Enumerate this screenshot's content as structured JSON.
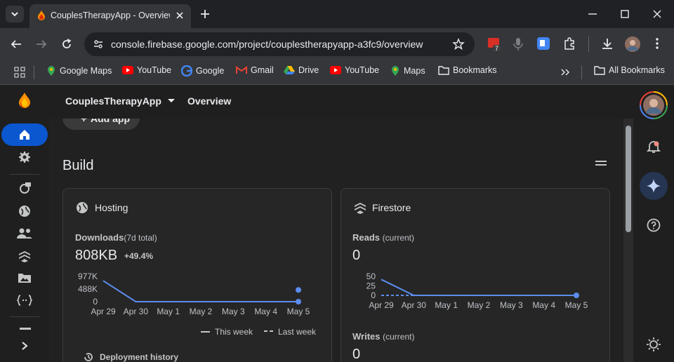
{
  "browser": {
    "tab_title": "CouplesTherapyApp - Overview",
    "url": "console.firebase.google.com/project/couplestherapyapp-a3fc9/overview",
    "extension_badge": "7",
    "bookmarks": [
      "Google Maps",
      "YouTube",
      "Google",
      "Gmail",
      "Drive",
      "YouTube",
      "Maps",
      "Bookmarks"
    ],
    "all_bookmarks": "All Bookmarks"
  },
  "console": {
    "project_name": "CouplesTherapyApp",
    "page_title": "Overview",
    "add_app_label": "Add app",
    "section_title": "Build"
  },
  "hosting": {
    "title": "Hosting",
    "metric_label": "Downloads",
    "metric_qualifier": "(7d total)",
    "metric_value": "808KB",
    "metric_change": "+49.4%",
    "chart_data": {
      "type": "line",
      "categories": [
        "Apr 29",
        "Apr 30",
        "May 1",
        "May 2",
        "May 3",
        "May 4",
        "May 5"
      ],
      "y_ticks": [
        "977K",
        "488K",
        "0"
      ],
      "ylim": [
        0,
        977
      ],
      "series": [
        {
          "name": "This week",
          "values": [
            810,
            0,
            0,
            0,
            0,
            0,
            0
          ],
          "color": "#5b8def",
          "style": "solid"
        },
        {
          "name": "Last week",
          "values": [
            null,
            null,
            null,
            null,
            null,
            null,
            455
          ],
          "color": "#5b8def",
          "style": "dashed"
        }
      ],
      "legend": "bottom-right"
    },
    "legend_this_week": "This week",
    "legend_last_week": "Last week",
    "deployment_history": "Deployment history"
  },
  "firestore": {
    "title": "Firestore",
    "reads_label": "Reads",
    "reads_qualifier": "(current)",
    "reads_value": "0",
    "chart_data": {
      "type": "line",
      "categories": [
        "Apr 29",
        "Apr 30",
        "May 1",
        "May 2",
        "May 3",
        "May 4",
        "May 5"
      ],
      "y_ticks": [
        "50",
        "25",
        "0"
      ],
      "ylim": [
        0,
        50
      ],
      "series": [
        {
          "name": "This week",
          "values": [
            42,
            0,
            0,
            0,
            0,
            0,
            0
          ],
          "color": "#5b8def",
          "style": "solid"
        },
        {
          "name": "Last week",
          "values": [
            0,
            0,
            null,
            null,
            null,
            null,
            null
          ],
          "color": "#5b8def",
          "style": "dashed"
        }
      ]
    },
    "writes_label": "Writes",
    "writes_qualifier": "(current)",
    "writes_value": "0"
  }
}
